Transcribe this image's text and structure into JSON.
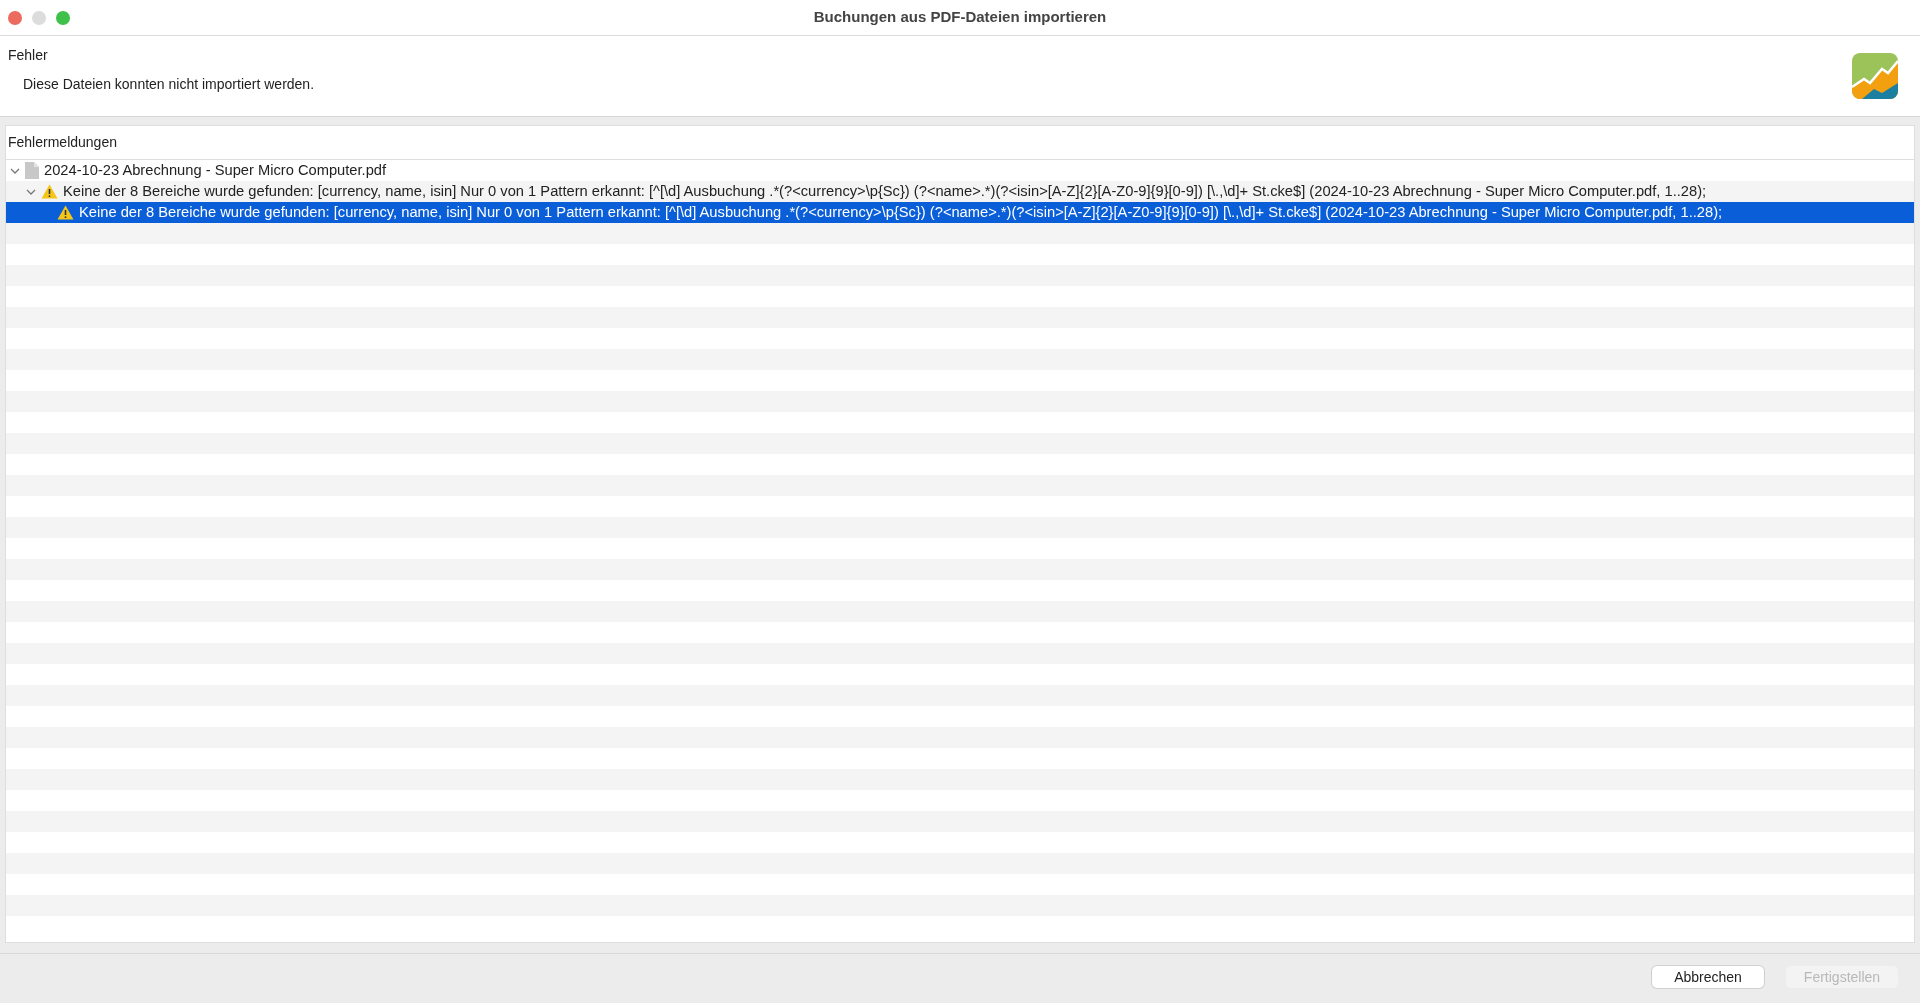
{
  "window": {
    "title": "Buchungen aus PDF-Dateien importieren"
  },
  "header": {
    "title": "Fehler",
    "message": "Diese Dateien konnten nicht importiert werden."
  },
  "table": {
    "columns": [
      "Fehlermeldungen"
    ],
    "rows": [
      {
        "kind": "file",
        "label": "2024-10-23 Abrechnung - Super Micro Computer.pdf",
        "expanded": true,
        "selected": false,
        "children": [
          {
            "kind": "warning",
            "label": "Keine der 8 Bereiche wurde gefunden: [currency, name, isin] Nur 0 von 1 Pattern erkannt: [^[\\d] Ausbuchung .*(?<currency>\\p{Sc}) (?<name>.*)(?<isin>[A-Z]{2}[A-Z0-9]{9}[0-9]) [\\.,\\d]+ St.cke$] (2024-10-23 Abrechnung - Super Micro Computer.pdf, 1..28);",
            "expanded": true,
            "selected": false,
            "children": [
              {
                "kind": "warning",
                "label": "Keine der 8 Bereiche wurde gefunden: [currency, name, isin] Nur 0 von 1 Pattern erkannt: [^[\\d] Ausbuchung .*(?<currency>\\p{Sc}) (?<name>.*)(?<isin>[A-Z]{2}[A-Z0-9]{9}[0-9]) [\\.,\\d]+ St.cke$] (2024-10-23 Abrechnung - Super Micro Computer.pdf, 1..28);",
                "selected": true
              }
            ]
          }
        ]
      }
    ]
  },
  "buttons": [
    {
      "label": "Abbrechen",
      "disabled": false
    },
    {
      "label": "Fertigstellen",
      "disabled": true
    }
  ]
}
